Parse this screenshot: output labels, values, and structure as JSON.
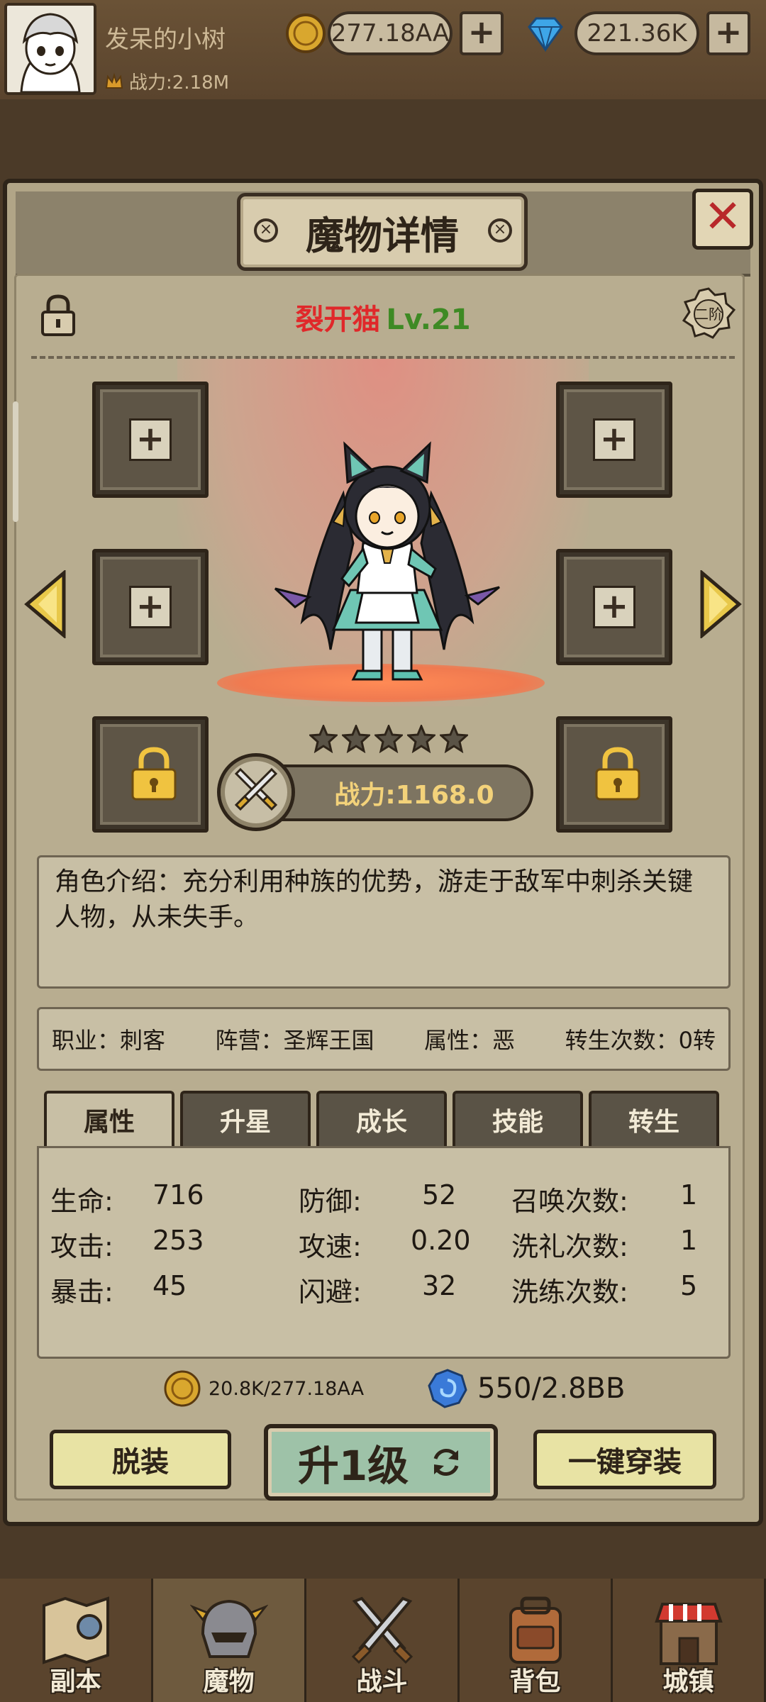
{
  "player": {
    "name": "发呆的小树",
    "power_label": "战力:2.18M"
  },
  "resources": {
    "gold": "277.18AA",
    "gems": "221.36K"
  },
  "dialog": {
    "title": "魔物详情",
    "close_label": "✕"
  },
  "monster": {
    "name": "裂开猫",
    "level": "Lv.21",
    "tier": "二阶",
    "stars": 5,
    "power_label": "战力:1168.0",
    "description": "角色介绍：充分利用种族的优势，游走于敌军中刺杀关键人物，从未失手。"
  },
  "info": {
    "job": "职业：刺客",
    "faction": "阵营：圣辉王国",
    "attribute": "属性：恶",
    "rebirth": "转生次数：0转"
  },
  "tabs": [
    {
      "label": "属性",
      "active": true
    },
    {
      "label": "升星",
      "active": false
    },
    {
      "label": "成长",
      "active": false
    },
    {
      "label": "技能",
      "active": false
    },
    {
      "label": "转生",
      "active": false
    }
  ],
  "stats": {
    "hp": {
      "label": "生命:",
      "value": "716"
    },
    "atk": {
      "label": "攻击:",
      "value": "253"
    },
    "crit": {
      "label": "暴击:",
      "value": "45"
    },
    "def": {
      "label": "防御:",
      "value": "52"
    },
    "spd": {
      "label": "攻速:",
      "value": "0.20"
    },
    "dodge": {
      "label": "闪避:",
      "value": "32"
    },
    "summon": {
      "label": "召唤次数:",
      "value": "1"
    },
    "baptism": {
      "label": "洗礼次数:",
      "value": "1"
    },
    "refine": {
      "label": "洗练次数:",
      "value": "5"
    }
  },
  "cost": {
    "gold": "20.8K/277.18AA",
    "essence": "550/2.8BB"
  },
  "buttons": {
    "unequip": "脱装",
    "upgrade": "升1级",
    "equip_all": "一键穿装"
  },
  "nav": [
    {
      "label": "副本",
      "icon": "map-icon",
      "active": false
    },
    {
      "label": "魔物",
      "icon": "monster-helmet-icon",
      "active": true
    },
    {
      "label": "战斗",
      "icon": "crossed-swords-icon",
      "active": false
    },
    {
      "label": "背包",
      "icon": "backpack-icon",
      "active": false
    },
    {
      "label": "城镇",
      "icon": "town-icon",
      "active": false
    }
  ],
  "colors": {
    "name_red": "#e0282a",
    "level_green": "#3e8a24",
    "power_gold": "#f3d27a",
    "button_yellow": "#e8e3a4",
    "upgrade_green": "#9ec2a8"
  }
}
